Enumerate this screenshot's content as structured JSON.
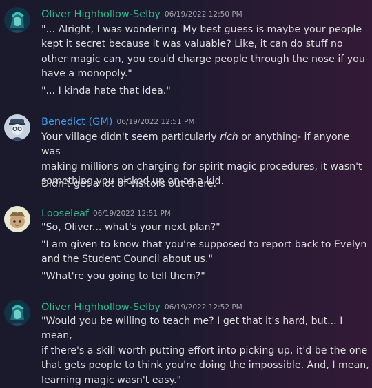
{
  "messages": [
    {
      "author": "Oliver Highhollow-Selby",
      "timestamp": "06/19/2022 12:50 PM",
      "lines": [
        "\"... Alright, I was wondering. My best guess is maybe your people\nkept it secret because it was valuable? Like, it can do stuff no\nother magic can, you could charge people through the nose if you\nhave a monopoly.\"",
        "\"... I kinda hate that idea.\""
      ]
    },
    {
      "author": "Benedict (GM)",
      "timestamp": "06/19/2022 12:51 PM",
      "line1_pre": "Your village didn't seem particularly ",
      "line1_italic": "rich",
      "line1_post": " or anything- if anyone was\nmaking millions on charging for spirit magic procedures, it wasn't\nsomething you picked up on as a kid.",
      "line2": "Didn't get a lot of visitors out there."
    },
    {
      "author": "Looseleaf",
      "timestamp": "06/19/2022 12:51 PM",
      "lines": [
        "\"So, Oliver... what's your next plan?\"",
        "\"I am given to know that you're supposed to report back to Evelyn\nand the Student Council about us.\"",
        "\"What're you going to tell them?\""
      ]
    },
    {
      "author": "Oliver Highhollow-Selby",
      "timestamp": "06/19/2022 12:52 PM",
      "lines": [
        "\"Would you be willing to teach me? I get that it's hard, but... I mean,\nif there's a skill worth putting effort into picking up, it'd be the one\nthat gets people to think you're doing the impossible. And, I mean,\nlearning magic wasn't easy.\""
      ]
    }
  ]
}
